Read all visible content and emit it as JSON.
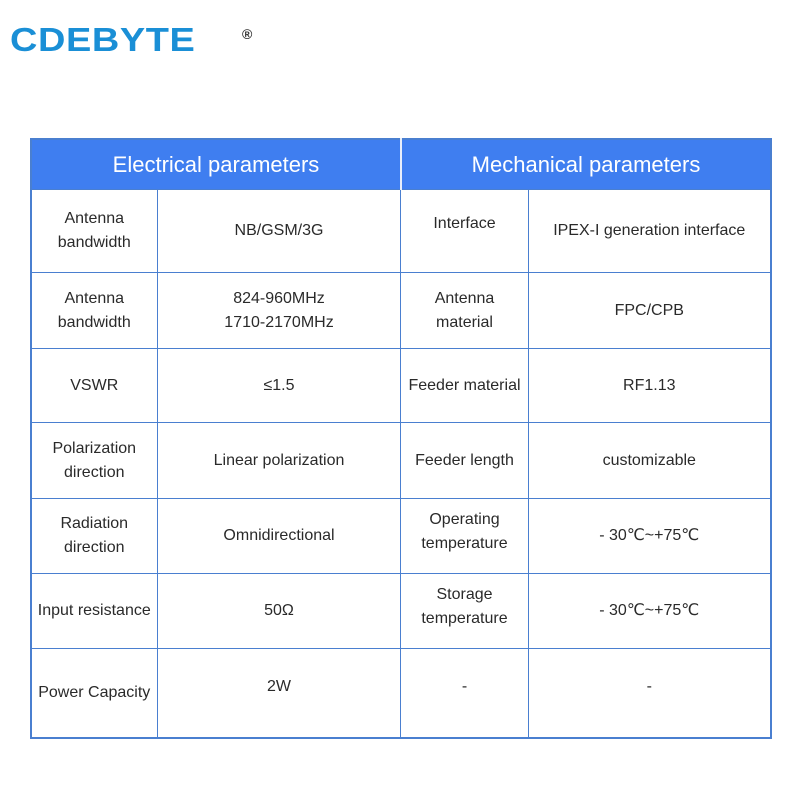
{
  "brand": {
    "name": "CDEBYTE",
    "registered_mark": "®",
    "color": "#1a8fd6"
  },
  "table": {
    "header_color": "#3f7ef0",
    "border_color": "#4a7fd0",
    "headers": [
      "Electrical parameters",
      "Mechanical parameters"
    ],
    "rows": [
      {
        "e_label": "Antenna\nbandwidth",
        "e_value": "NB/GSM/3G",
        "m_label": "Interface",
        "m_value": "IPEX-I generation interface"
      },
      {
        "e_label": "Antenna\nbandwidth",
        "e_value": "824-960MHz\n1710-2170MHz",
        "m_label": "Antenna\nmaterial",
        "m_value": "FPC/CPB"
      },
      {
        "e_label": "VSWR",
        "e_value": "≤1.5",
        "m_label": "Feeder material",
        "m_value": "RF1.13"
      },
      {
        "e_label": "Polarization\ndirection",
        "e_value": "Linear polarization",
        "m_label": "Feeder length",
        "m_value": "customizable"
      },
      {
        "e_label": "Radiation\ndirection",
        "e_value": "Omnidirectional",
        "m_label": "Operating\ntemperature",
        "m_value": "- 30℃~+75℃"
      },
      {
        "e_label": "Input resistance",
        "e_value": "50Ω",
        "m_label": "Storage\ntemperature",
        "m_value": "- 30℃~+75℃"
      },
      {
        "e_label": "Power Capacity",
        "e_value": "2W",
        "m_label": "-",
        "m_value": "-"
      }
    ]
  }
}
